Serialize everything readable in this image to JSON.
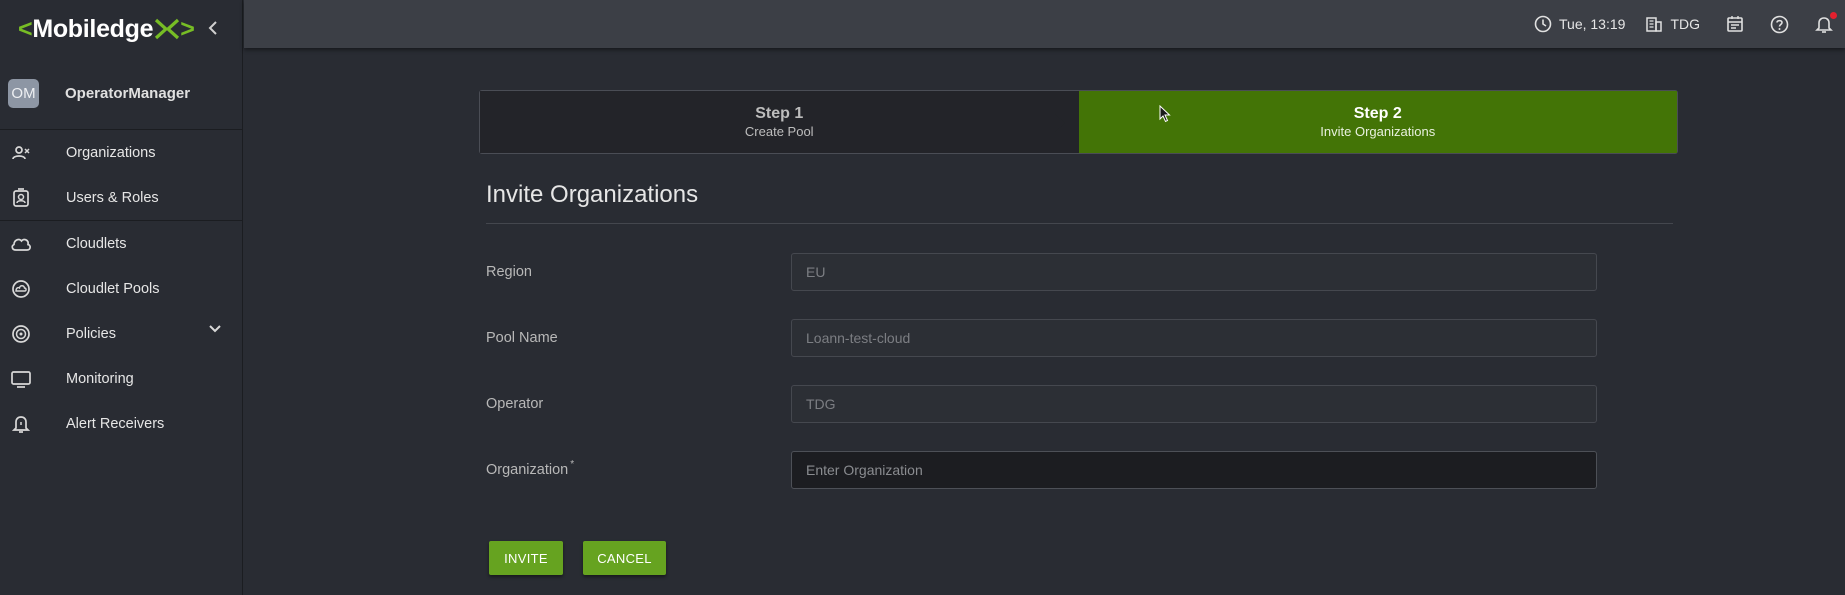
{
  "brand": {
    "logo_text": "Mobiledge",
    "accent": "#77bd25"
  },
  "user": {
    "initials": "OM",
    "name": "OperatorManager"
  },
  "sidebar": {
    "items": [
      {
        "label": "Organizations",
        "icon": "organizations-icon"
      },
      {
        "label": "Users & Roles",
        "icon": "users-roles-icon"
      },
      {
        "label": "Cloudlets",
        "icon": "cloud-icon"
      },
      {
        "label": "Cloudlet Pools",
        "icon": "cloudlet-pool-icon"
      },
      {
        "label": "Policies",
        "icon": "policies-icon"
      },
      {
        "label": "Monitoring",
        "icon": "monitor-icon"
      },
      {
        "label": "Alert Receivers",
        "icon": "alert-bell-icon"
      }
    ]
  },
  "header": {
    "datetime": "Tue, 13:19",
    "organization": "TDG"
  },
  "stepper": {
    "steps": [
      {
        "title": "Step 1",
        "subtitle": "Create Pool"
      },
      {
        "title": "Step 2",
        "subtitle": "Invite Organizations"
      }
    ],
    "active_color": "#437406"
  },
  "form": {
    "title": "Invite Organizations",
    "fields": [
      {
        "label": "Region",
        "value": "EU"
      },
      {
        "label": "Pool Name",
        "value": "Loann-test-cloud"
      },
      {
        "label": "Operator",
        "value": "TDG"
      },
      {
        "label": "Organization",
        "required_mark": "*",
        "placeholder": "Enter Organization"
      }
    ],
    "invite_label": "INVITE",
    "cancel_label": "CANCEL",
    "button_color": "#66a320"
  }
}
